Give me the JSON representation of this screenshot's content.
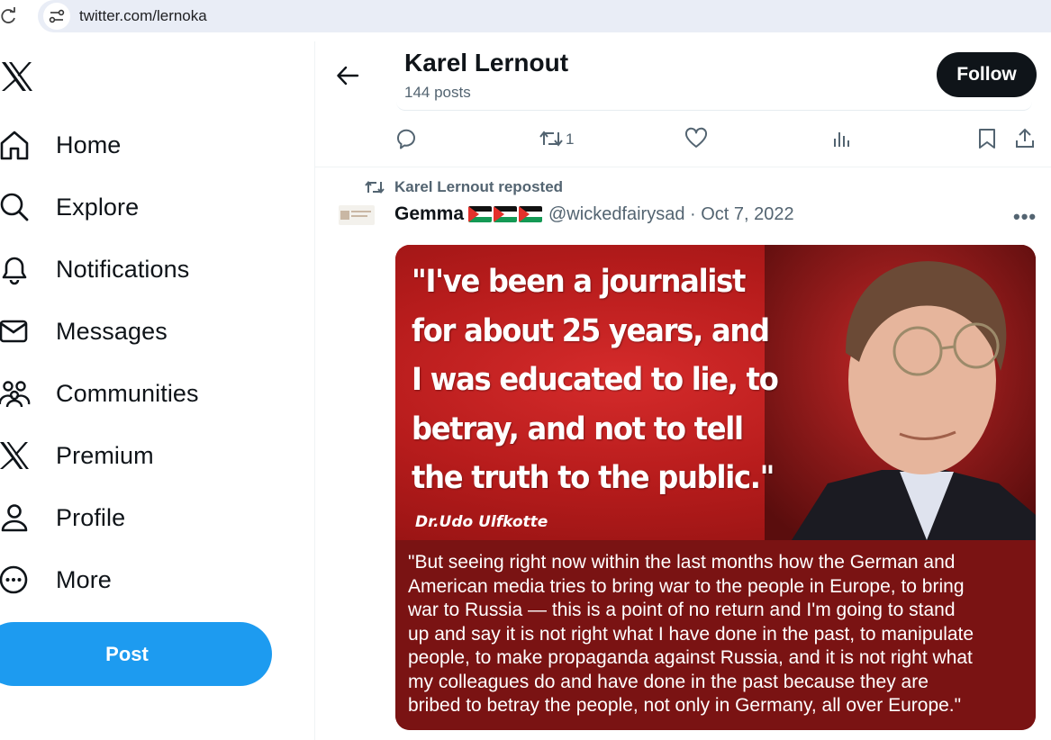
{
  "browser": {
    "url": "twitter.com/lernoka"
  },
  "nav": {
    "items": [
      {
        "label": "Home",
        "icon": "home-icon"
      },
      {
        "label": "Explore",
        "icon": "search-icon"
      },
      {
        "label": "Notifications",
        "icon": "bell-icon"
      },
      {
        "label": "Messages",
        "icon": "envelope-icon"
      },
      {
        "label": "Communities",
        "icon": "people-icon"
      },
      {
        "label": "Premium",
        "icon": "x-logo-icon"
      },
      {
        "label": "Profile",
        "icon": "person-icon"
      },
      {
        "label": "More",
        "icon": "more-circle-icon"
      }
    ],
    "post_label": "Post"
  },
  "header": {
    "name": "Karel Lernout",
    "post_count": "144 posts",
    "follow_label": "Follow"
  },
  "prev_tweet_actions": {
    "retweet_count": "1"
  },
  "tweet": {
    "repost_label": "Karel Lernout reposted",
    "author_name": "Gemma",
    "handle_date": "@wickedfairysad · Oct 7, 2022",
    "more": "•••",
    "image": {
      "quote_lines": [
        "\"I've been a journalist",
        "for about 25 years, and",
        "I was educated to lie, to",
        "betray, and not to tell",
        "the truth to the public.\""
      ],
      "attribution": "Dr.Udo Ulfkotte",
      "body_lines": [
        "\"But seeing right now within the last months how the German and",
        "American media tries to bring war to the people in Europe, to bring",
        "war to Russia — this is a point of no return and I'm going to stand",
        "up and say it is not right what I have done in the past, to manipulate",
        "people, to make propaganda against Russia, and it is not right what",
        "my colleagues do and have done in the past because they are",
        "bribed to betray the people, not only in Germany, all over Europe.\""
      ]
    }
  },
  "colors": {
    "accent": "#1d9bf0",
    "text": "#0f1419",
    "muted": "#536471",
    "image_red": "#b71c1c"
  }
}
